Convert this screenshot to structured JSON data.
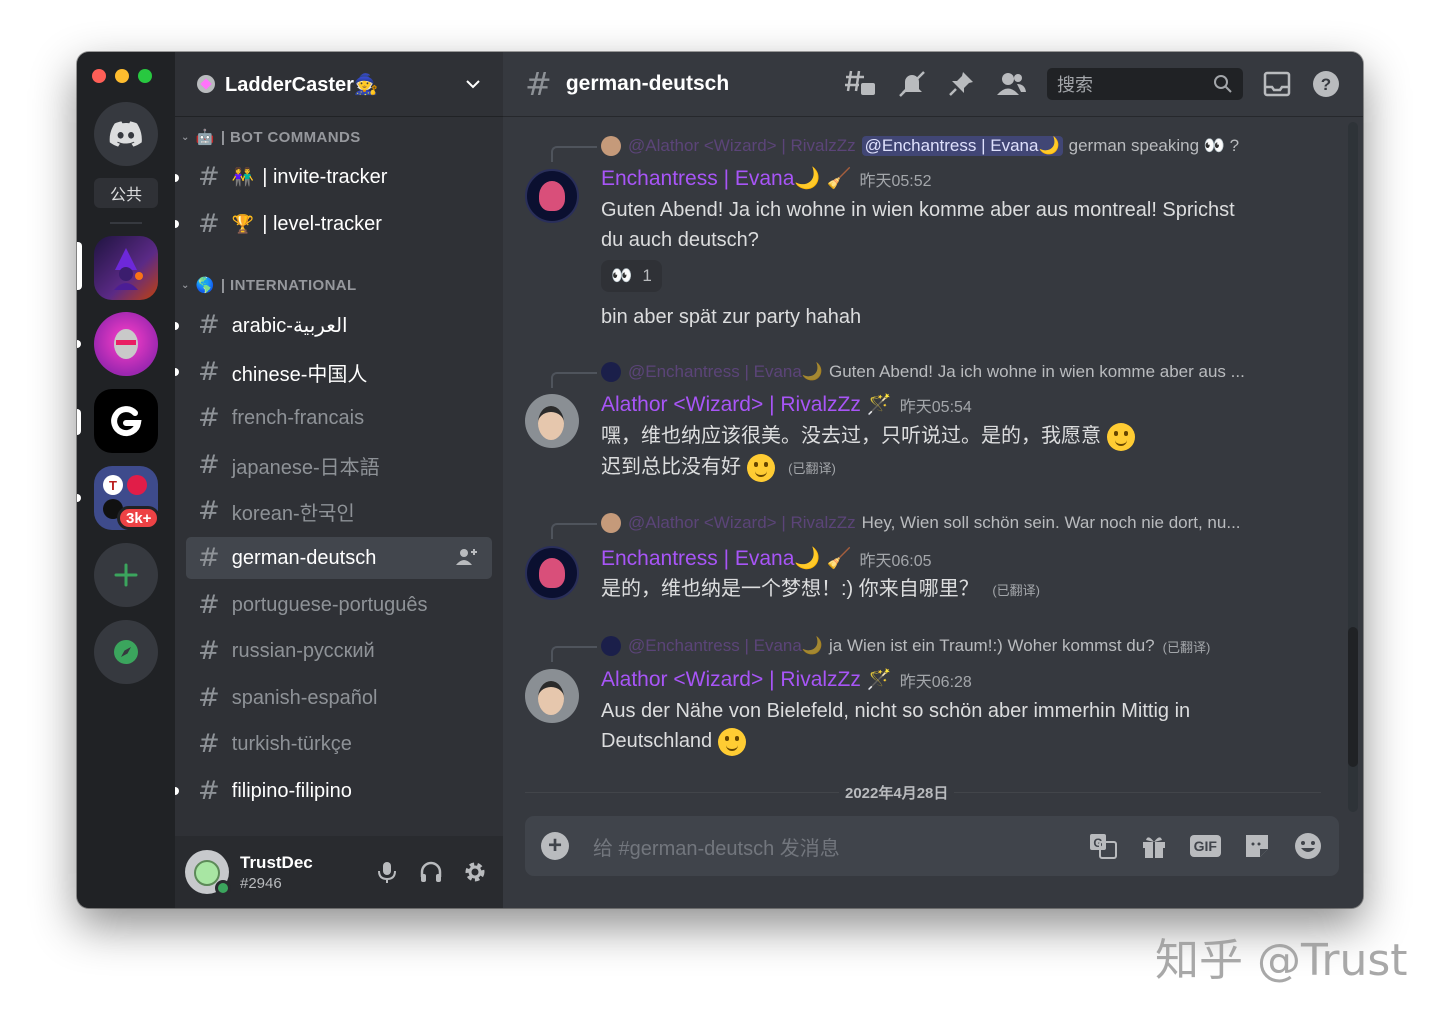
{
  "server": {
    "name": "LadderCaster🧙",
    "public_label": "公共",
    "badge": "3k+"
  },
  "categories": [
    {
      "label": "| BOT COMMANDS",
      "emoji": "🤖"
    },
    {
      "label": "| INTERNATIONAL",
      "emoji": "🌎"
    }
  ],
  "bot_channels": [
    {
      "emoji": "👫",
      "label": "| invite-tracker"
    },
    {
      "emoji": "🏆",
      "label": "| level-tracker"
    }
  ],
  "channels": [
    {
      "label": "arabic-العربية",
      "unread": true
    },
    {
      "label": "chinese-中国人",
      "unread": true
    },
    {
      "label": "french-francais",
      "unread": false
    },
    {
      "label": "japanese-日本語",
      "unread": false
    },
    {
      "label": "korean-한국인",
      "unread": false
    },
    {
      "label": "german-deutsch",
      "unread": false,
      "active": true
    },
    {
      "label": "portuguese-português",
      "unread": false
    },
    {
      "label": "russian-русский",
      "unread": false
    },
    {
      "label": "spanish-español",
      "unread": false
    },
    {
      "label": "turkish-türkçe",
      "unread": false
    },
    {
      "label": "filipino-filipino",
      "unread": true
    }
  ],
  "user": {
    "name": "TrustDec",
    "tag": "#2946"
  },
  "header": {
    "channel": "german-deutsch",
    "search_placeholder": "搜索"
  },
  "messages": [
    {
      "reply_author": "@Alathor <Wizard> | RivalzZz",
      "reply_mention": "@Enchantress | Evana🌙",
      "reply_text": "german speaking 👀 ?",
      "author": "Enchantress | Evana🌙",
      "author_extra": "🧹",
      "time": "昨天05:52",
      "lines": [
        "Guten Abend! Ja ich wohne in wien komme aber aus montreal! Sprichst",
        "du auch deutsch?"
      ],
      "reaction": {
        "emoji": "👀",
        "count": "1"
      },
      "followup": "bin aber spät zur party hahah"
    },
    {
      "reply_author": "@Enchantress | Evana🌙",
      "reply_text": "Guten Abend! Ja ich wohne in wien komme aber aus ...",
      "author": "Alathor <Wizard> | RivalzZz",
      "author_extra": "🪄",
      "time": "昨天05:54",
      "lines": [
        "嘿，维也纳应该很美。没去过，只听说过。是的，我愿意",
        "迟到总比没有好"
      ],
      "translated": "(已翻译)"
    },
    {
      "reply_author": "@Alathor <Wizard> | RivalzZz",
      "reply_text": "Hey, Wien soll schön sein. War noch nie dort, nu...",
      "author": "Enchantress | Evana🌙",
      "author_extra": "🧹",
      "time": "昨天06:05",
      "lines": [
        "是的，维也纳是一个梦想！:) 你来自哪里？"
      ],
      "translated": "(已翻译)"
    },
    {
      "reply_author": "@Enchantress | Evana🌙",
      "reply_text": "ja Wien ist ein Traum!:) Woher kommst du?",
      "reply_translated": "(已翻译)",
      "author": "Alathor <Wizard> | RivalzZz",
      "author_extra": "🪄",
      "time": "昨天06:28",
      "lines": [
        "Aus der Nähe von Bielefeld, nicht so schön aber immerhin Mittig in",
        "Deutschland"
      ]
    }
  ],
  "date_divider": "2022年4月28日",
  "composer": {
    "placeholder": "给 #german-deutsch 发消息",
    "gif_label": "GIF"
  },
  "watermark": "知乎 @Trust",
  "colors": {
    "accent_name": "#a855f7",
    "rail": "#202225",
    "sidebar": "#2f3136",
    "chat": "#36393f",
    "online": "#3ba55d",
    "add_server": "#3ba55d"
  }
}
